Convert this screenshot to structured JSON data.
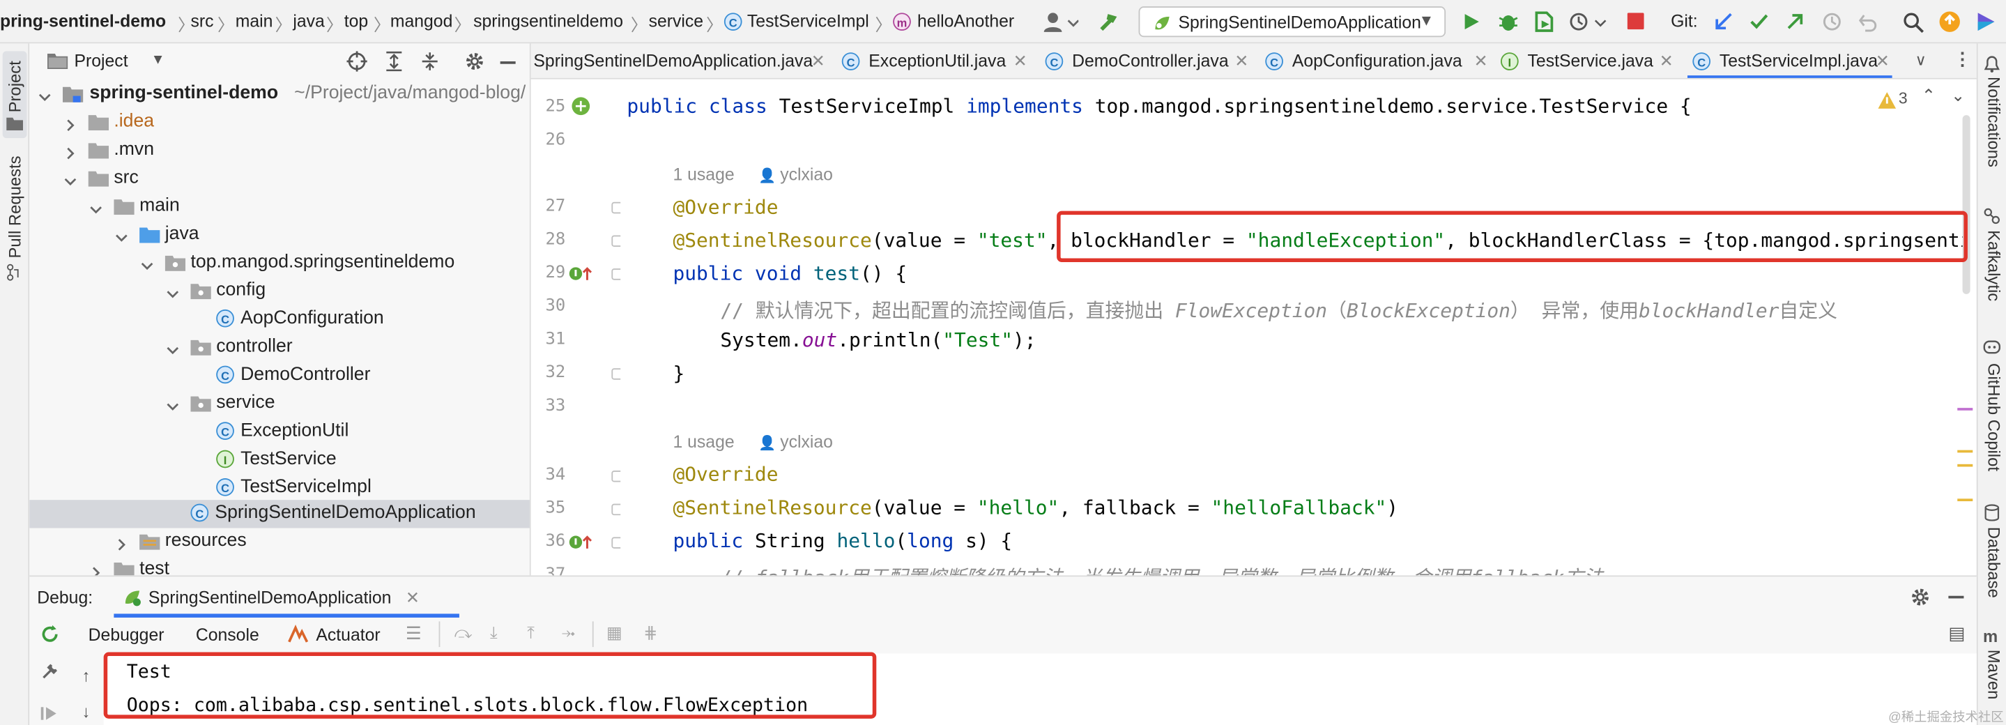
{
  "breadcrumb": [
    "pring-sentinel-demo",
    "src",
    "main",
    "java",
    "top",
    "mangod",
    "springsentineldemo",
    "service",
    "TestServiceImpl",
    "helloAnother"
  ],
  "toolbar": {
    "run_config": "SpringSentinelDemoApplication",
    "git_label": "Git:"
  },
  "left_stripe": {
    "project": "Project",
    "pull_requests": "Pull Requests"
  },
  "project_panel": {
    "title": "Project",
    "tree": [
      {
        "label": "spring-sentinel-demo",
        "suffix": "~/Project/java/mangod-blog/",
        "level": 0,
        "type": "module",
        "expanded": true
      },
      {
        "label": ".idea",
        "level": 1,
        "type": "folder",
        "expanded": false,
        "color": "#b8681e"
      },
      {
        "label": ".mvn",
        "level": 1,
        "type": "folder",
        "expanded": false
      },
      {
        "label": "src",
        "level": 1,
        "type": "folder",
        "expanded": true
      },
      {
        "label": "main",
        "level": 2,
        "type": "folder",
        "expanded": true
      },
      {
        "label": "java",
        "level": 3,
        "type": "source-folder",
        "expanded": true
      },
      {
        "label": "top.mangod.springsentineldemo",
        "level": 4,
        "type": "package",
        "expanded": true
      },
      {
        "label": "config",
        "level": 5,
        "type": "package",
        "expanded": true
      },
      {
        "label": "AopConfiguration",
        "level": 6,
        "type": "class"
      },
      {
        "label": "controller",
        "level": 5,
        "type": "package",
        "expanded": true
      },
      {
        "label": "DemoController",
        "level": 6,
        "type": "class"
      },
      {
        "label": "service",
        "level": 5,
        "type": "package",
        "expanded": true
      },
      {
        "label": "ExceptionUtil",
        "level": 6,
        "type": "class"
      },
      {
        "label": "TestService",
        "level": 6,
        "type": "interface"
      },
      {
        "label": "TestServiceImpl",
        "level": 6,
        "type": "class"
      },
      {
        "label": "SpringSentinelDemoApplication",
        "level": 5,
        "type": "spring-class",
        "selected": true
      },
      {
        "label": "resources",
        "level": 3,
        "type": "resources-folder",
        "expanded": false
      },
      {
        "label": "test",
        "level": 2,
        "type": "folder",
        "expanded": false
      }
    ]
  },
  "editor": {
    "tabs": [
      {
        "label": "SpringSentinelDemoApplication.java",
        "icon": "spring"
      },
      {
        "label": "ExceptionUtil.java",
        "icon": "class"
      },
      {
        "label": "DemoController.java",
        "icon": "class"
      },
      {
        "label": "AopConfiguration.java",
        "icon": "class"
      },
      {
        "label": "TestService.java",
        "icon": "interface"
      },
      {
        "label": "TestServiceImpl.java",
        "icon": "class",
        "active": true
      }
    ],
    "warning_count": "3",
    "line_numbers": [
      "25",
      "26",
      "27",
      "28",
      "29",
      "30",
      "31",
      "32",
      "33",
      "34",
      "35",
      "36",
      "37"
    ],
    "usage_hints": [
      {
        "count": "1 usage",
        "author": "yclxiao"
      },
      {
        "count": "1 usage",
        "author": "yclxiao"
      }
    ],
    "lines": {
      "l25": {
        "kw1": "public class ",
        "cls": "TestServiceImpl ",
        "kw2": "implements ",
        "rest": "top.mangod.springsentineldemo.service.TestService {"
      },
      "l27": {
        "ann": "@Override"
      },
      "l28": {
        "ann": "@SentinelResource",
        "p1": "(value = ",
        "s1": "\"test\"",
        "p2": ", blockHandler = ",
        "s2": "\"handleException\"",
        "p3": ", blockHandlerClass = {top.mangod.springsenti"
      },
      "l29": {
        "kw": "public void ",
        "name": "test",
        "rest": "() {"
      },
      "l30": {
        "c1": "// 默认情况下，超出配置的流控阈值后，直接抛出 ",
        "ci1": "FlowException",
        "c2": "（",
        "ci2": "BlockException",
        "c3": "） 异常，使用",
        "ci3": "blockHandler",
        "c4": "自定义"
      },
      "l31": {
        "a": "System.",
        "b": "out",
        "c": ".println(",
        "d": "\"Test\"",
        "e": ");"
      },
      "l32": {
        "a": "}"
      },
      "l34": {
        "ann": "@Override"
      },
      "l35": {
        "ann": "@SentinelResource",
        "p1": "(value = ",
        "s1": "\"hello\"",
        "p2": ", fallback = ",
        "s2": "\"helloFallback\"",
        "p3": ")"
      },
      "l36": {
        "kw": "public ",
        "type": "String ",
        "name": "hello",
        "p": "(",
        "kw2": "long ",
        "rest": "s) {"
      },
      "l37": {
        "a": "// fallback用于配置熔断降级的方法，当发生慢调用、异常数、异常比例数，会调用fallback方法"
      }
    }
  },
  "right_stripe": {
    "notifications": "Notifications",
    "kafkalytic": "Kafkalytic",
    "copilot": "GitHub Copilot",
    "database": "Database",
    "maven": "Maven"
  },
  "debug": {
    "label": "Debug:",
    "config": "SpringSentinelDemoApplication",
    "tabs": [
      "Debugger",
      "Console",
      "Actuator"
    ],
    "console_lines": [
      "Test",
      "Oops: com.alibaba.csp.sentinel.slots.block.flow.FlowException"
    ]
  },
  "watermark": "@稀土掘金技术社区"
}
